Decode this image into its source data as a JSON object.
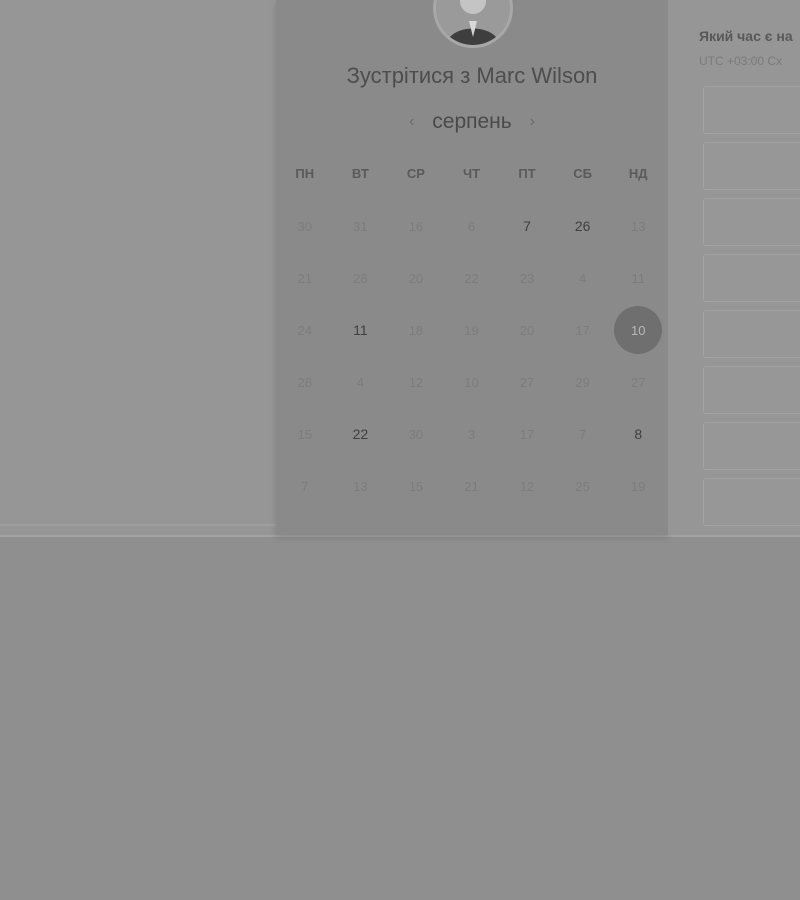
{
  "scheduler": {
    "title": "Зустрітися з Marc Wilson",
    "month": "серпень",
    "prev_icon": "chevron-left-icon",
    "next_icon": "chevron-right-icon",
    "weekdays": [
      "ПН",
      "ВТ",
      "СР",
      "ЧТ",
      "ПТ",
      "СБ",
      "НД"
    ],
    "days": [
      "30",
      "31",
      "16",
      "6",
      "7",
      "26",
      "13",
      "21",
      "28",
      "20",
      "22",
      "23",
      "4",
      "11",
      "24",
      "11",
      "18",
      "19",
      "20",
      "17",
      "10",
      "28",
      "4",
      "12",
      "10",
      "27",
      "29",
      "27",
      "15",
      "22",
      "30",
      "3",
      "17",
      "7",
      "8",
      "7",
      "13",
      "15",
      "21",
      "12",
      "25",
      "19"
    ],
    "available_days": [
      "7",
      "26",
      "11",
      "22",
      "8"
    ],
    "selected_day": "10"
  },
  "times": {
    "heading": "Який час є на",
    "timezone": "UTC +03:00 Сх",
    "slot_count": 8
  },
  "colors": {
    "overlay": "#8f8f8f",
    "panel": "#8a8a8a",
    "selected": "#6f6f6f"
  }
}
